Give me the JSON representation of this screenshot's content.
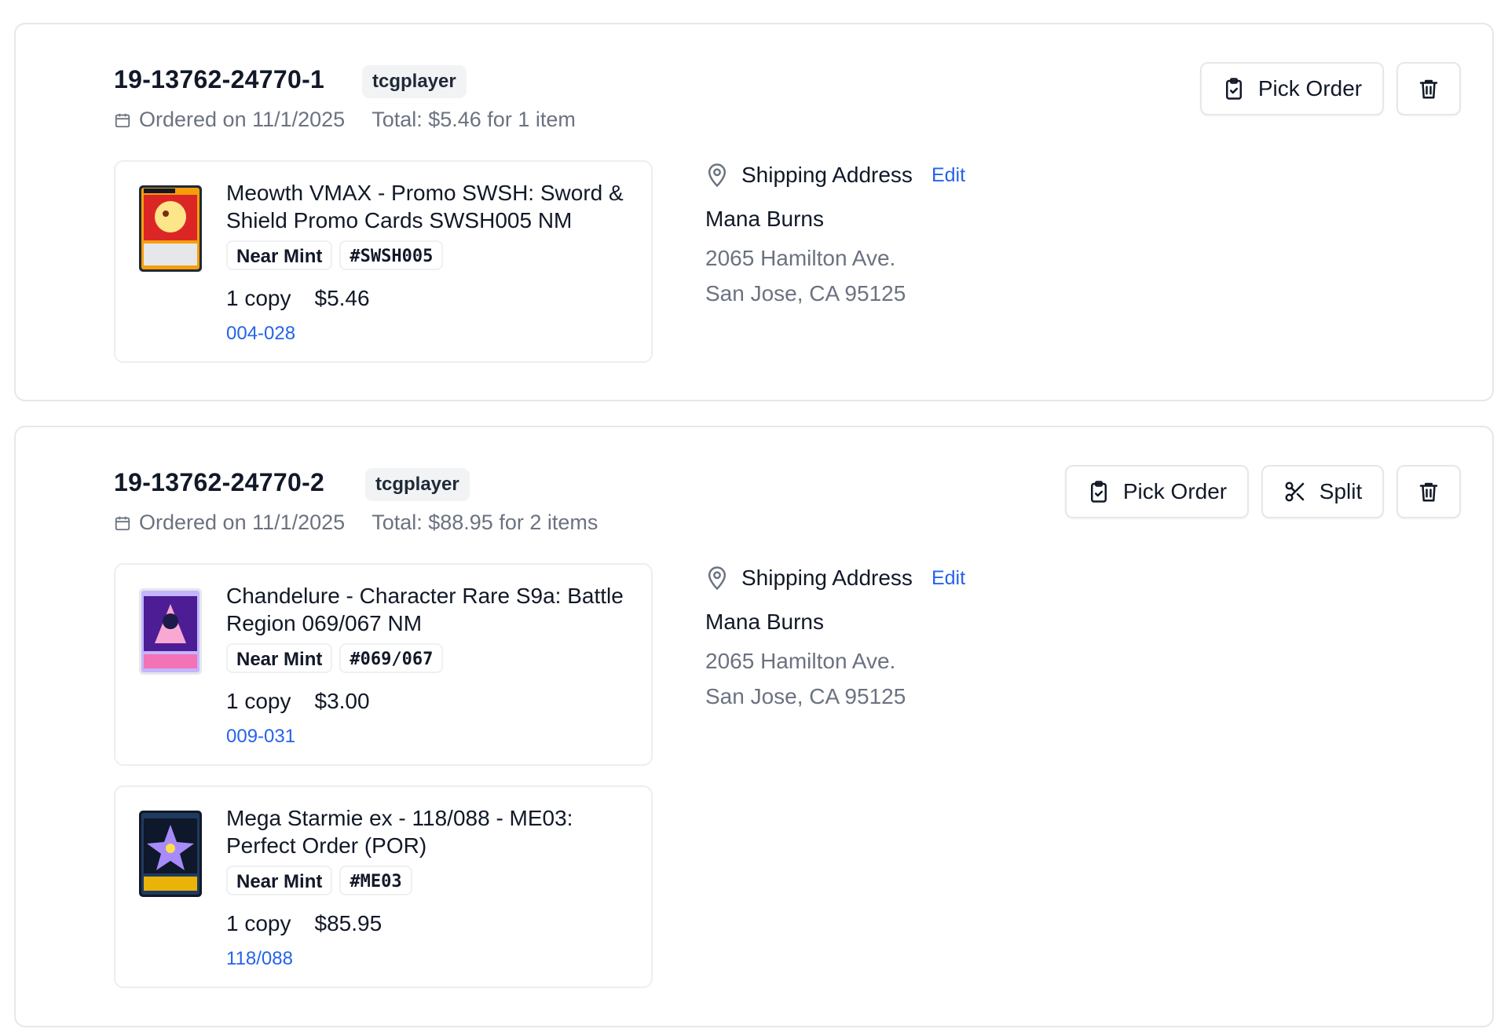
{
  "orders": [
    {
      "id": "19-13762-24770-1",
      "source": "tcgplayer",
      "ordered_on": "Ordered on 11/1/2025",
      "total": "Total: $5.46 for 1 item",
      "actions": {
        "pick_label": "Pick Order"
      },
      "items": [
        {
          "title": "Meowth VMAX - Promo SWSH: Sword & Shield Promo Cards SWSH005 NM",
          "condition": "Near Mint",
          "number": "#SWSH005",
          "qty": "1 copy",
          "price": "$5.46",
          "location": "004-028"
        }
      ],
      "shipping": {
        "heading": "Shipping Address",
        "edit_label": "Edit",
        "name": "Mana Burns",
        "line1": "2065 Hamilton Ave.",
        "line2": "San Jose, CA 95125"
      }
    },
    {
      "id": "19-13762-24770-2",
      "source": "tcgplayer",
      "ordered_on": "Ordered on 11/1/2025",
      "total": "Total: $88.95 for 2 items",
      "actions": {
        "pick_label": "Pick Order",
        "split_label": "Split"
      },
      "items": [
        {
          "title": "Chandelure - Character Rare S9a: Battle Region 069/067 NM",
          "condition": "Near Mint",
          "number": "#069/067",
          "qty": "1 copy",
          "price": "$3.00",
          "location": "009-031"
        },
        {
          "title": "Mega Starmie ex - 118/088 - ME03: Perfect Order (POR)",
          "condition": "Near Mint",
          "number": "#ME03",
          "qty": "1 copy",
          "price": "$85.95",
          "location": "118/088"
        }
      ],
      "shipping": {
        "heading": "Shipping Address",
        "edit_label": "Edit",
        "name": "Mana Burns",
        "line1": "2065 Hamilton Ave.",
        "line2": "San Jose, CA 95125"
      }
    }
  ],
  "icons": {
    "calendar": "calendar-icon",
    "clipboard": "clipboard-check-icon",
    "trash": "trash-icon",
    "scissors": "scissors-icon",
    "pin": "map-pin-icon"
  },
  "colors": {
    "link": "#2563eb",
    "muted": "#6b7280",
    "text": "#111827",
    "border": "#e5e7eb",
    "badge_bg": "#f1f3f5"
  }
}
